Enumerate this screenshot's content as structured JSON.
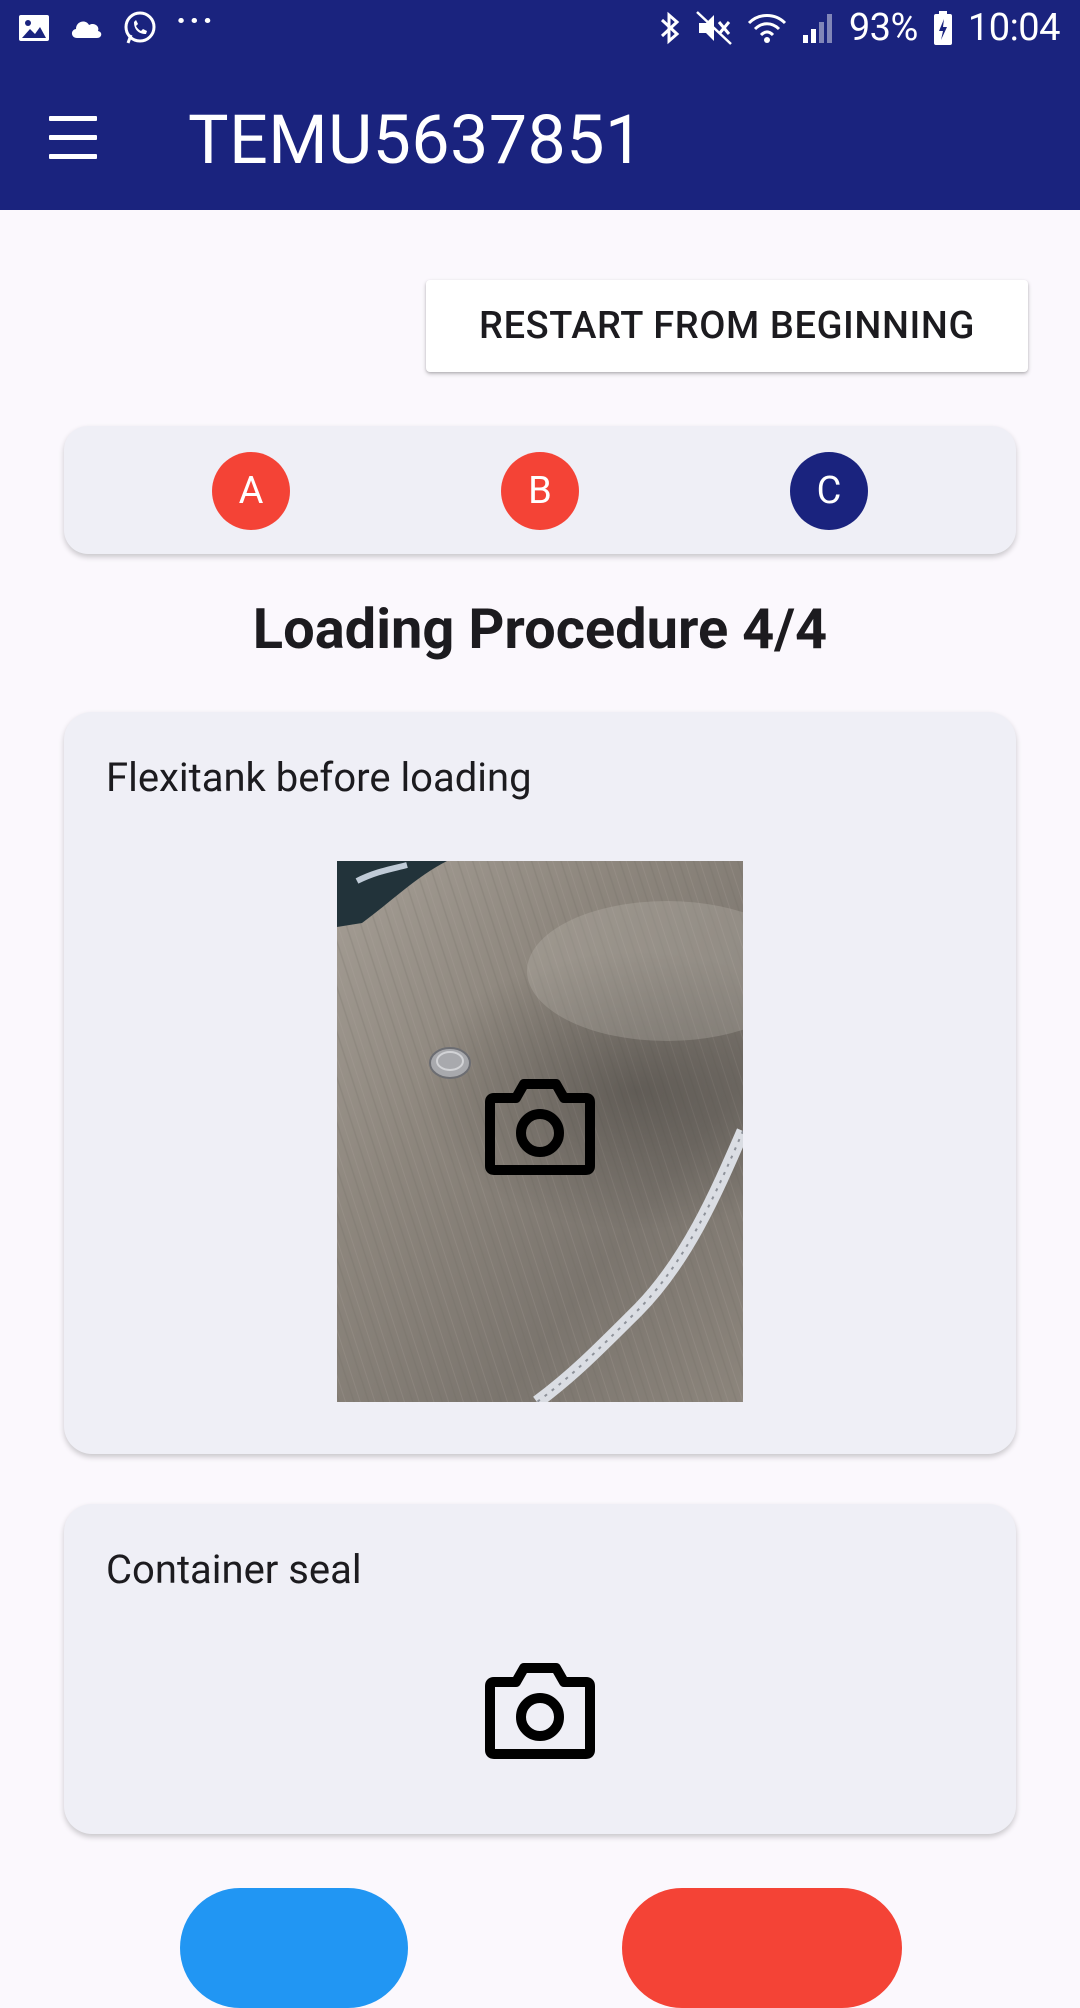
{
  "status_bar": {
    "left_icons": [
      "gallery-icon",
      "cloud-icon",
      "whatsapp-icon",
      "more-dots-icon"
    ],
    "more_label": "···",
    "right_icons": [
      "bluetooth-icon",
      "mute-icon",
      "wifi-icon",
      "signal-icon",
      "battery-charging-icon"
    ],
    "battery": "93%",
    "time": "10:04"
  },
  "app_bar": {
    "title": "TEMU5637851",
    "menu_icon": "menu-icon",
    "background": "#1a237e"
  },
  "restart_button": {
    "label": "RESTART FROM BEGINNING"
  },
  "stepper": {
    "steps": [
      {
        "label": "A",
        "color": "#f44336"
      },
      {
        "label": "B",
        "color": "#f44336"
      },
      {
        "label": "C",
        "color": "#1a237e"
      }
    ]
  },
  "procedure": {
    "title": "Loading Procedure 4/4"
  },
  "photo_cards": [
    {
      "label": "Flexitank before loading",
      "has_photo": true,
      "icon": "camera-icon"
    },
    {
      "label": "Container seal",
      "has_photo": false,
      "icon": "camera-icon"
    }
  ],
  "bottom_buttons": [
    {
      "color": "#2196f3"
    },
    {
      "color": "#f44336"
    }
  ]
}
